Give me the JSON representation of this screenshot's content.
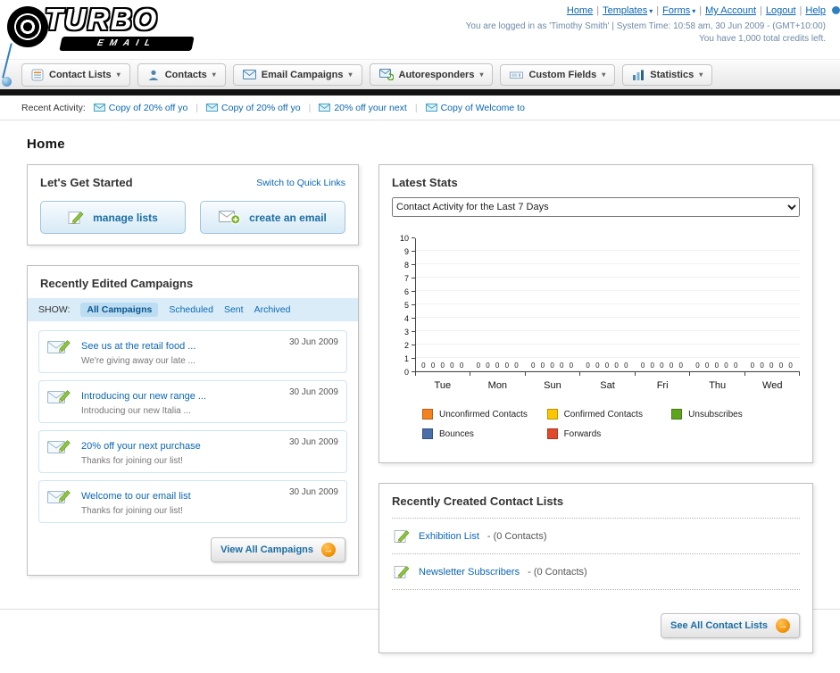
{
  "header": {
    "logo_line1": "TURBO",
    "logo_line2": "EMAIL",
    "top_links": [
      {
        "label": "Home",
        "dropdown": false
      },
      {
        "label": "Templates",
        "dropdown": true
      },
      {
        "label": "Forms",
        "dropdown": true
      },
      {
        "label": "My Account",
        "dropdown": false
      },
      {
        "label": "Logout",
        "dropdown": false
      },
      {
        "label": "Help",
        "dropdown": false
      }
    ],
    "login_info": "You are logged in as 'Timothy Smith' | System Time: 10:58 am, 30 Jun 2009 - (GMT+10:00)",
    "credits": "You have 1,000 total credits left."
  },
  "nav": {
    "tabs": [
      {
        "label": "Contact Lists",
        "icon": "contact-lists-icon"
      },
      {
        "label": "Contacts",
        "icon": "contacts-icon"
      },
      {
        "label": "Email Campaigns",
        "icon": "email-campaigns-icon"
      },
      {
        "label": "Autoresponders",
        "icon": "autoresponders-icon"
      },
      {
        "label": "Custom Fields",
        "icon": "custom-fields-icon"
      },
      {
        "label": "Statistics",
        "icon": "statistics-icon"
      }
    ]
  },
  "recent_activity": {
    "label": "Recent Activity:",
    "items": [
      "Copy of 20% off yo",
      "Copy of 20% off yo",
      "20% off your next",
      "Copy of Welcome to"
    ]
  },
  "page_title": "Home",
  "get_started": {
    "title": "Let's Get Started",
    "switch_link": "Switch to Quick Links",
    "buttons": [
      {
        "label": "manage lists"
      },
      {
        "label": "create an email"
      }
    ]
  },
  "campaigns": {
    "title": "Recently Edited Campaigns",
    "show_label": "SHOW:",
    "filters": [
      "All Campaigns",
      "Scheduled",
      "Sent",
      "Archived"
    ],
    "active_filter": "All Campaigns",
    "items": [
      {
        "title": "See us at the retail food ...",
        "subtitle": "We're giving away our late ...",
        "date": "30 Jun 2009"
      },
      {
        "title": "Introducing our new range ...",
        "subtitle": "Introducing our new Italia ...",
        "date": "30 Jun 2009"
      },
      {
        "title": "20% off your next purchase",
        "subtitle": "Thanks for joining our list!",
        "date": "30 Jun 2009"
      },
      {
        "title": "Welcome to our email list",
        "subtitle": "Thanks for joining our list!",
        "date": "30 Jun 2009"
      }
    ],
    "view_all_label": "View All Campaigns"
  },
  "stats": {
    "title": "Latest Stats",
    "dropdown_value": "Contact Activity for the Last 7 Days",
    "chart_data": {
      "type": "bar",
      "title": "Contact Activity for the Last 7 Days",
      "categories": [
        "Tue",
        "Mon",
        "Sun",
        "Sat",
        "Fri",
        "Thu",
        "Wed"
      ],
      "series": [
        {
          "name": "Unconfirmed Contacts",
          "color": "#F5821F",
          "values": [
            0,
            0,
            0,
            0,
            0,
            0,
            0
          ]
        },
        {
          "name": "Confirmed Contacts",
          "color": "#FDC500",
          "values": [
            0,
            0,
            0,
            0,
            0,
            0,
            0
          ]
        },
        {
          "name": "Unsubscribes",
          "color": "#5EA51C",
          "values": [
            0,
            0,
            0,
            0,
            0,
            0,
            0
          ]
        },
        {
          "name": "Bounces",
          "color": "#4A6EA9",
          "values": [
            0,
            0,
            0,
            0,
            0,
            0,
            0
          ]
        },
        {
          "name": "Forwards",
          "color": "#E2492C",
          "values": [
            0,
            0,
            0,
            0,
            0,
            0,
            0
          ]
        }
      ],
      "xlabel": "",
      "ylabel": "",
      "ylim": [
        0,
        10
      ],
      "yticks": [
        0,
        1,
        2,
        3,
        4,
        5,
        6,
        7,
        8,
        9,
        10
      ],
      "grid": true,
      "legend_position": "bottom"
    }
  },
  "contact_lists": {
    "title": "Recently Created Contact Lists",
    "items": [
      {
        "name": "Exhibition List",
        "detail": " - (0 Contacts)"
      },
      {
        "name": "Newsletter Subscribers",
        "detail": " - (0 Contacts)"
      }
    ],
    "see_all_label": "See All Contact Lists"
  }
}
